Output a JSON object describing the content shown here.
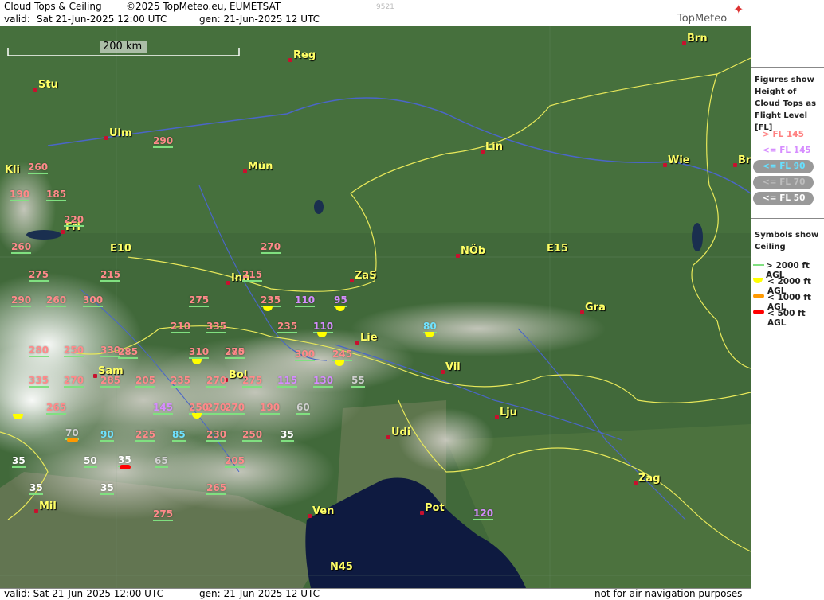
{
  "header": {
    "title": "Cloud Tops & Ceiling",
    "copyright": "©2025 TopMeteo.eu, EUMETSAT",
    "valid_label": "valid:",
    "valid_value": "Sat  21-Jun-2025  12:00 UTC",
    "gen": "gen: 21-Jun-2025 12 UTC",
    "code": "9521",
    "brand": "TopMeteo"
  },
  "scale_label": "200 km",
  "footer": {
    "valid": "valid:  Sat   21-Jun-2025   12:00 UTC",
    "gen": "gen: 21-Jun-2025 12 UTC",
    "disclaimer": "not for air navigation purposes"
  },
  "legend": {
    "tops_title": "Figures show Height of Cloud Tops as Flight Level  [FL]",
    "tops": [
      {
        "label": "> FL 145",
        "color": "#ff8080"
      },
      {
        "label": "<= FL 145",
        "color": "#d68cff"
      },
      {
        "label": "<= FL 90",
        "color": "#66e0ff"
      },
      {
        "label": "<= FL 70",
        "color": "#bdbdbd"
      },
      {
        "label": "<= FL 50",
        "color": "#ffffff"
      }
    ],
    "ceiling_title": "Symbols show Ceiling",
    "ceiling": [
      {
        "label": "> 2000 ft AGL",
        "color": "#80e080"
      },
      {
        "label": "< 2000 ft AGL",
        "color": "#ffff00"
      },
      {
        "label": "< 1000 ft AGL",
        "color": "#ff9900"
      },
      {
        "label": "< 500 ft AGL",
        "color": "#ff0000"
      }
    ]
  },
  "places": [
    "Brn",
    "Reg",
    "Stu",
    "Ulm",
    "Lin",
    "Wie",
    "Br",
    "Kli",
    "Mün",
    "Fri",
    "E10",
    "NÖb",
    "E15",
    "ZaS",
    "Inn",
    "Gra",
    "Lie",
    "Vil",
    "Bol",
    "Sam",
    "Lju",
    "Udi",
    "Zag",
    "Mil",
    "Ven",
    "Pot",
    "N45"
  ],
  "flight_levels": [
    "290",
    "260",
    "190",
    "185",
    "220",
    "260",
    "270",
    "275",
    "215",
    "215",
    "290",
    "260",
    "300",
    "275",
    "235",
    "110",
    "95",
    "210",
    "335",
    "235",
    "110",
    "80",
    "280",
    "250",
    "330",
    "310",
    "280",
    "285",
    "275",
    "300",
    "245",
    "335",
    "270",
    "285",
    "205",
    "235",
    "270",
    "275",
    "115",
    "130",
    "55",
    "270",
    "265",
    "145",
    "250",
    "270",
    "190",
    "60",
    "70",
    "90",
    "225",
    "85",
    "230",
    "250",
    "35",
    "35",
    "50",
    "35",
    "65",
    "205",
    "35",
    "35",
    "265",
    "275",
    "120"
  ],
  "ceiling_symbols": [
    "yellow",
    "yellow",
    "yellow",
    "yellow",
    "yellow",
    "yellow",
    "yellow",
    "yellow",
    "yellow",
    "orange",
    "red"
  ]
}
